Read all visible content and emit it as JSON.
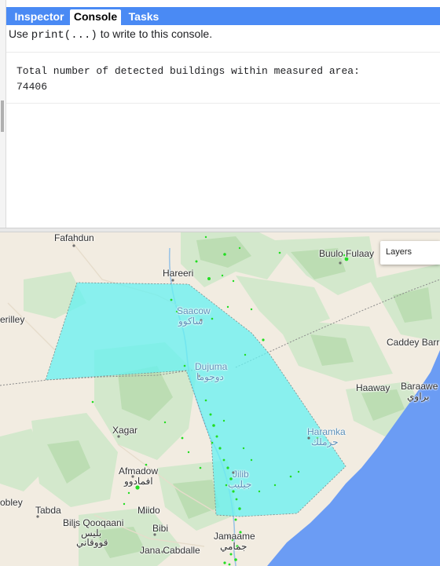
{
  "tabs": {
    "inspector": "Inspector",
    "console": "Console",
    "tasks": "Tasks"
  },
  "console": {
    "hint_prefix": "Use ",
    "hint_code": "print(...)",
    "hint_suffix": " to write to this console.",
    "output_line1": "Total number of detected buildings within measured area:",
    "output_line2": "74406"
  },
  "map": {
    "layers_label": "Layers",
    "places": {
      "fafahdun": "Fafahdun",
      "hareeri": "Hareeri",
      "buulo_fulaay": "Buulo Fulaay",
      "saacow": "Saacow",
      "saacow_ar": "ساكوو",
      "erilley": "erilley",
      "caddey_barre": "Caddey Barre",
      "dujuma": "Dujuma",
      "dujuma_ar": "دوجوما",
      "haaway": "Haaway",
      "baraawe": "Baraawe",
      "baraawe_ar": "براوي",
      "xagar": "Xagar",
      "haramka": "Haramka",
      "haramka_ar": "حرملك",
      "afmadow": "Afmadow",
      "afmadow_ar": "افمادوو",
      "jilib": "Jilib",
      "jilib_ar": "جيليب",
      "obley": "obley",
      "tabda": "Tabda",
      "miido": "Miido",
      "bilis_qooqaani": "Bilis Qooqaani",
      "bilis_ar1": "بليس",
      "bilis_ar2": "قووقاني",
      "bibi": "Bibi",
      "jana_cabdalle": "Jana Cabdalle",
      "jamaame": "Jamaame",
      "jamaame_ar": "جمامي"
    },
    "colors": {
      "tab_bar": "#4a8af4",
      "land": "#f2ece1",
      "vegetation": "#cfe6c9",
      "ocean": "#6b9cf4",
      "area_fill": "#66f2f2",
      "detections": "#22dd22"
    }
  }
}
